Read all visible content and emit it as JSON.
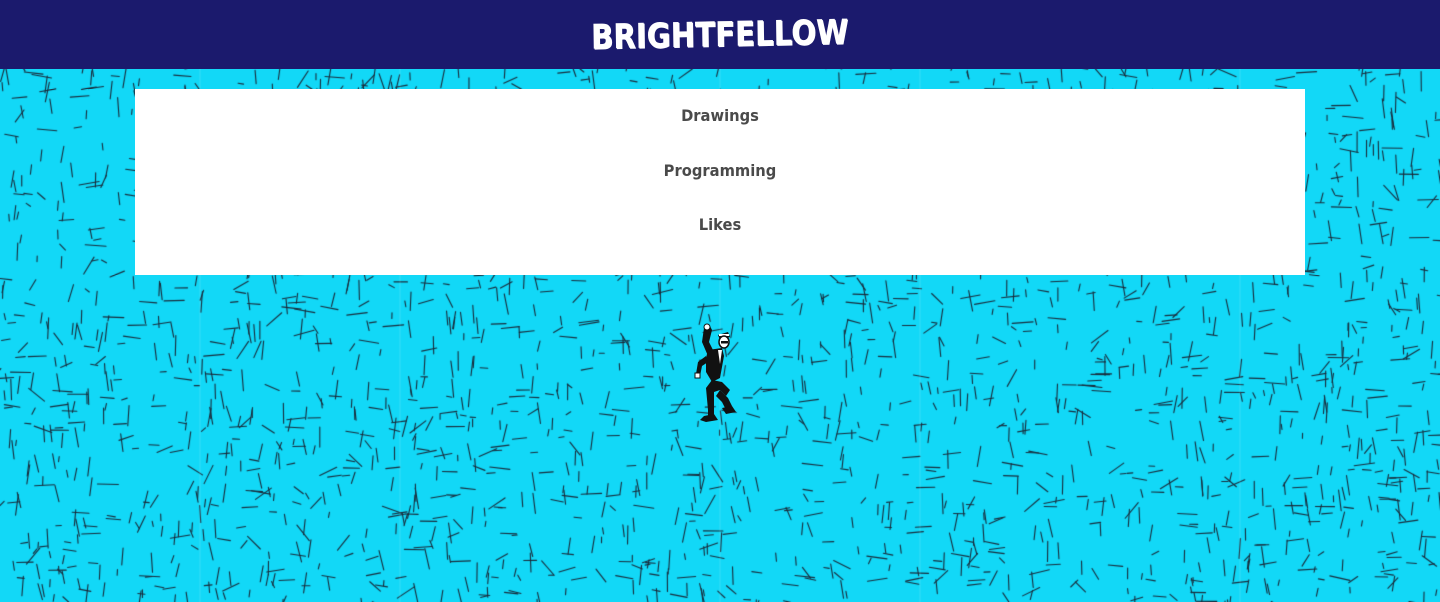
{
  "header": {
    "title": "BRIGHTFELLOW"
  },
  "nav": {
    "items": [
      {
        "label": "Drawings"
      },
      {
        "label": "Programming"
      },
      {
        "label": "Likes"
      }
    ]
  },
  "figure": {
    "icon": "dancing-man-icon"
  },
  "colors": {
    "background": "#12d8f7",
    "header": "#1b1a6d",
    "title": "#ffffff",
    "panel": "#ffffff",
    "nav_text": "#4a4a4a",
    "pattern_strokes": "#1a2a3a"
  }
}
